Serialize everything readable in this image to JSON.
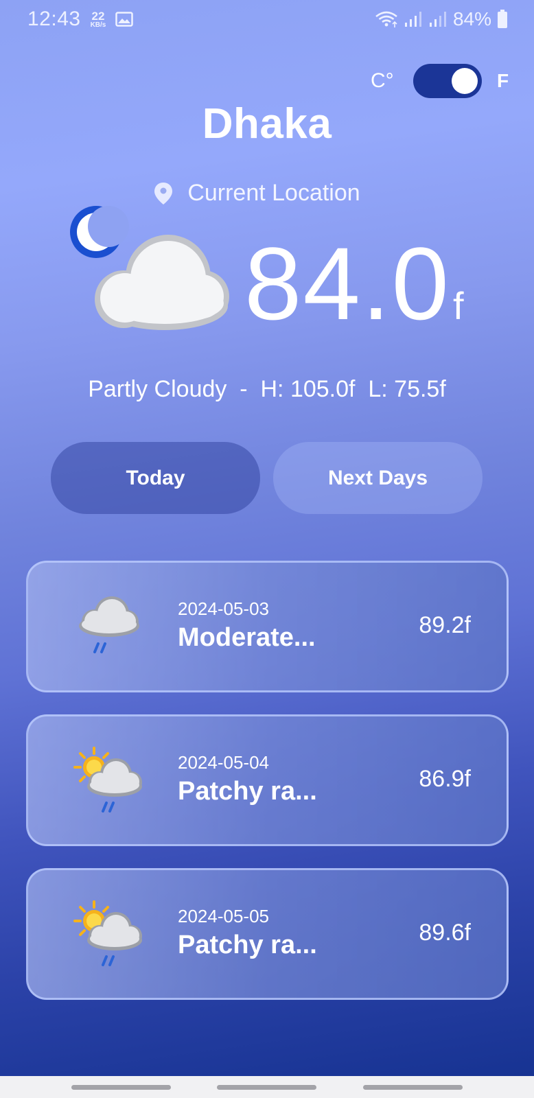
{
  "status_bar": {
    "time": "12:43",
    "net_speed_value": "22",
    "net_speed_unit": "KB/s",
    "battery_percent": "84%",
    "icons": [
      "gallery-icon",
      "wifi-icon",
      "signal-icon",
      "signal-icon",
      "battery-icon"
    ]
  },
  "unit_toggle": {
    "celsius_label": "C°",
    "fahrenheit_label": "F",
    "selected": "F"
  },
  "city": "Dhaka",
  "location_label": "Current Location",
  "current": {
    "icon": "night-partly-cloudy-icon",
    "temperature": "84.0",
    "temperature_unit": "f",
    "summary": "Partly Cloudy  -  H: 105.0f  L: 75.5f"
  },
  "tabs": [
    {
      "label": "Today",
      "active": true
    },
    {
      "label": "Next Days",
      "active": false
    }
  ],
  "forecast": [
    {
      "date": "2024-05-03",
      "condition": "Moderate...",
      "temp": "89.2f",
      "icon": "rain-cloud-icon"
    },
    {
      "date": "2024-05-04",
      "condition": "Patchy ra...",
      "temp": "86.9f",
      "icon": "sun-rain-cloud-icon"
    },
    {
      "date": "2024-05-05",
      "condition": "Patchy ra...",
      "temp": "89.6f",
      "icon": "sun-rain-cloud-icon"
    }
  ],
  "colors": {
    "gradient_top": "#94a8fb",
    "gradient_bottom": "#14318f",
    "switch_track": "#1b3597",
    "accent_white": "#ffffff"
  }
}
